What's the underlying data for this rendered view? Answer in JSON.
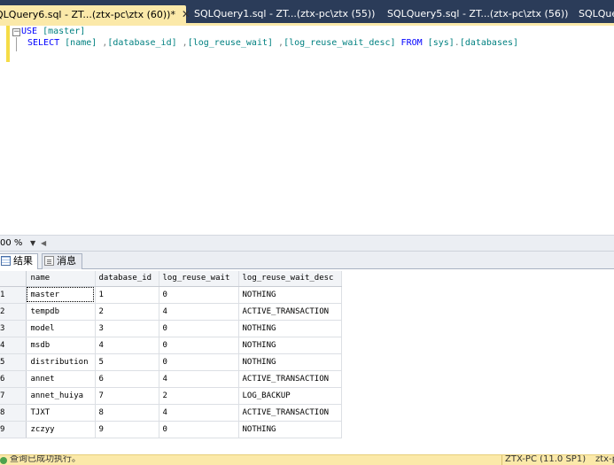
{
  "tabs": [
    {
      "label": "QLQuery6.sql - ZT...(ztx-pc\\ztx (60))*",
      "active": true,
      "close_icon": "close-icon"
    },
    {
      "label": "SQLQuery1.sql - ZT...(ztx-pc\\ztx (55))",
      "active": false
    },
    {
      "label": "SQLQuery5.sql - ZT...(ztx-pc\\ztx (56))",
      "active": false
    },
    {
      "label": "SQLQuer",
      "active": false
    }
  ],
  "editor": {
    "line1": {
      "kw": "USE",
      "db": "[master]"
    },
    "line2": {
      "kw_select": "SELECT",
      "col1": "[name]",
      "col2": "[database_id]",
      "col3": "[log_reuse_wait]",
      "col4": "[log_reuse_wait_desc]",
      "kw_from": "FROM",
      "schema": "[sys]",
      "table": "[databases]"
    }
  },
  "zoom": {
    "value": "00 %"
  },
  "result_tabs": {
    "results": "结果",
    "messages": "消息"
  },
  "grid": {
    "columns": [
      "name",
      "database_id",
      "log_reuse_wait",
      "log_reuse_wait_desc"
    ],
    "rows": [
      {
        "num": "1",
        "name": "master",
        "database_id": "1",
        "log_reuse_wait": "0",
        "log_reuse_wait_desc": "NOTHING"
      },
      {
        "num": "2",
        "name": "tempdb",
        "database_id": "2",
        "log_reuse_wait": "4",
        "log_reuse_wait_desc": "ACTIVE_TRANSACTION"
      },
      {
        "num": "3",
        "name": "model",
        "database_id": "3",
        "log_reuse_wait": "0",
        "log_reuse_wait_desc": "NOTHING"
      },
      {
        "num": "4",
        "name": "msdb",
        "database_id": "4",
        "log_reuse_wait": "0",
        "log_reuse_wait_desc": "NOTHING"
      },
      {
        "num": "5",
        "name": "distribution",
        "database_id": "5",
        "log_reuse_wait": "0",
        "log_reuse_wait_desc": "NOTHING"
      },
      {
        "num": "6",
        "name": "annet",
        "database_id": "6",
        "log_reuse_wait": "4",
        "log_reuse_wait_desc": "ACTIVE_TRANSACTION"
      },
      {
        "num": "7",
        "name": "annet_huiya",
        "database_id": "7",
        "log_reuse_wait": "2",
        "log_reuse_wait_desc": "LOG_BACKUP"
      },
      {
        "num": "8",
        "name": "TJXT",
        "database_id": "8",
        "log_reuse_wait": "4",
        "log_reuse_wait_desc": "ACTIVE_TRANSACTION"
      },
      {
        "num": "9",
        "name": "zczyy",
        "database_id": "9",
        "log_reuse_wait": "0",
        "log_reuse_wait_desc": "NOTHING"
      }
    ]
  },
  "status": {
    "message": "查询已成功执行。",
    "server": "ZTX-PC (11.0 SP1)",
    "extra": "ztx-p"
  },
  "colors": {
    "tabstrip_bg": "#2b3c59",
    "active_tab_bg": "#fbe9a9",
    "keyword": "#0000ff",
    "identifier": "#008080",
    "statusbar_bg": "#fbe9a9"
  }
}
